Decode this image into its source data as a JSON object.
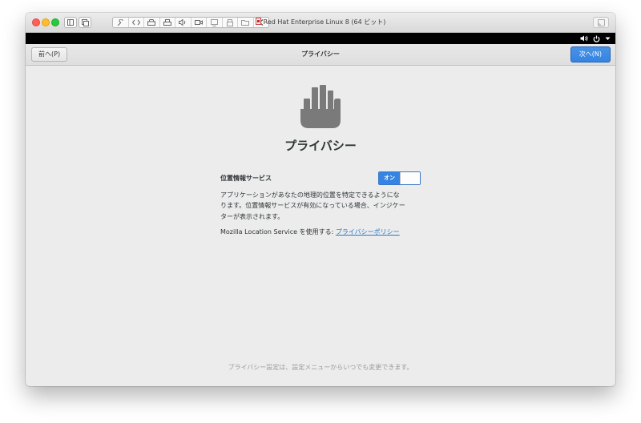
{
  "vm_window": {
    "title": "Red Hat Enterprise Linux 8 (64 ビット)"
  },
  "top_bar": {
    "icons": [
      "volume-icon",
      "power-icon",
      "caret-down-icon"
    ]
  },
  "header": {
    "prev_button": "前へ(P)",
    "title": "プライバシー",
    "next_button": "次へ(N)"
  },
  "main": {
    "icon": "hand-stop-icon",
    "heading": "プライバシー",
    "location_services_label": "位置情報サービス",
    "toggle": {
      "label": "オン",
      "state": true
    },
    "description_lines": [
      "アプリケーションがあなたの地理的位置を特定できるようにな",
      "ります。位置情報サービスが有効になっている場合、インジケー",
      "ターが表示されます。"
    ],
    "service_text": "Mozilla Location Service を使用する: ",
    "policy_link": "プライバシーポリシー"
  },
  "footer_note": "プライバシー設定は、設定メニューからいつでも変更できます。",
  "colors": {
    "accent": "#3584e4",
    "link": "#2a76c6",
    "background": "#ececec",
    "icon": "#7a7a7a"
  }
}
